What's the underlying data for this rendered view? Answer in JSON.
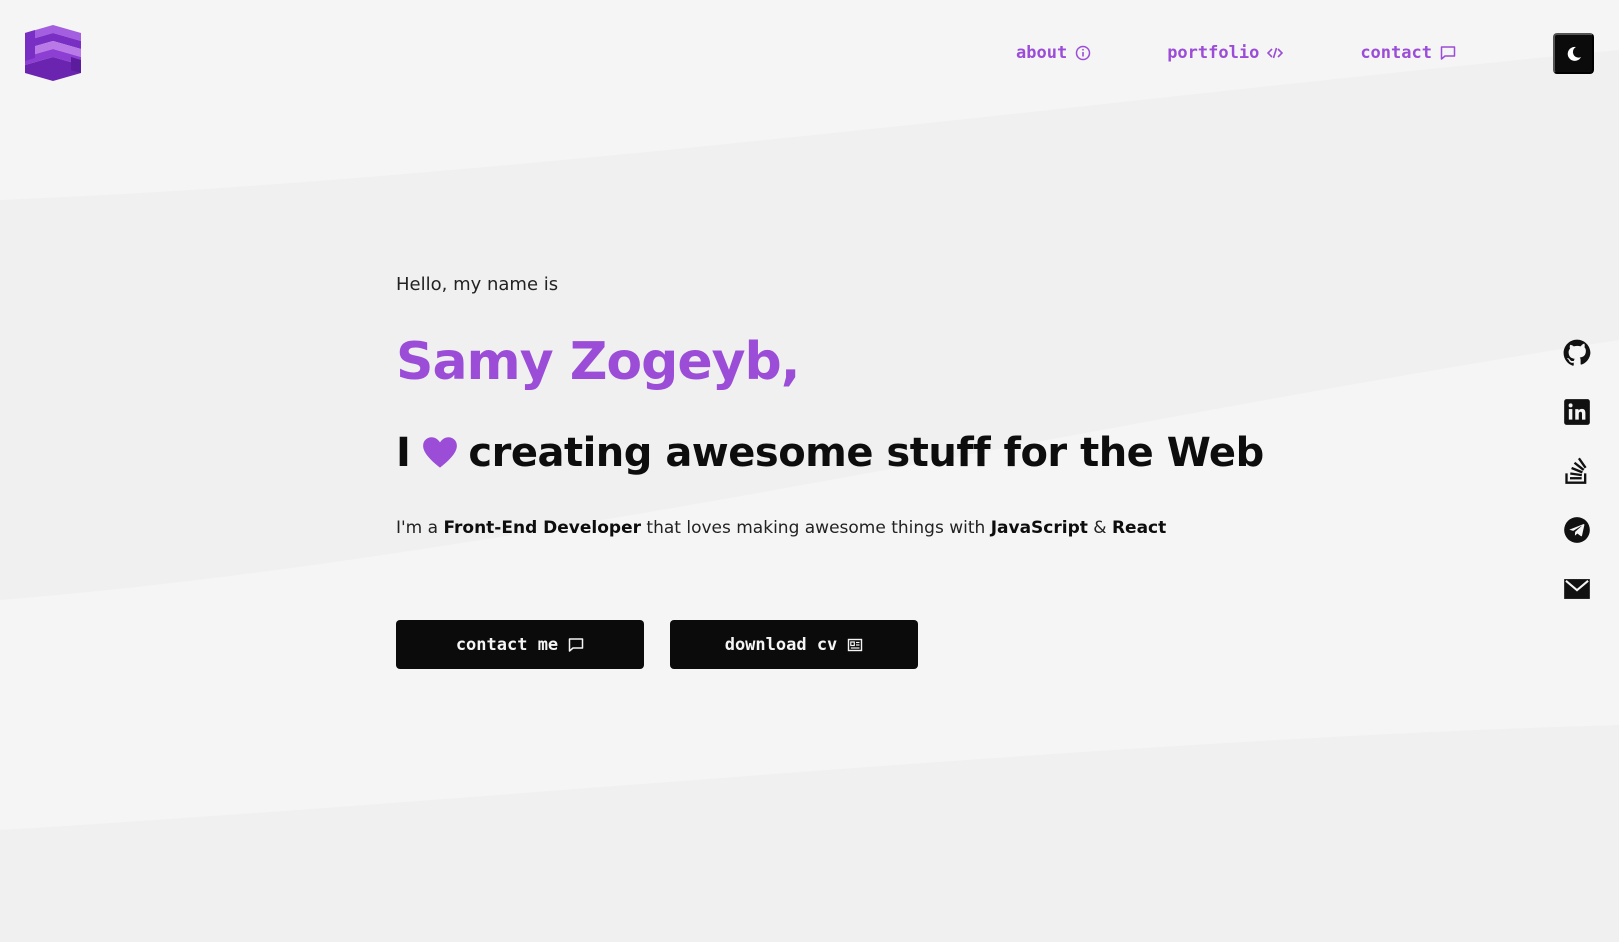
{
  "header": {
    "nav": [
      {
        "label": "about",
        "icon": "info-icon"
      },
      {
        "label": "portfolio",
        "icon": "code-icon"
      },
      {
        "label": "contact",
        "icon": "chat-icon"
      }
    ],
    "theme_toggle_icon": "moon-icon"
  },
  "hero": {
    "greeting": "Hello, my name is",
    "name": "Samy Zogeyb,",
    "tagline_prefix": "I",
    "tagline_suffix": "creating awesome stuff for the Web",
    "intro": {
      "part1": "I'm a ",
      "role": "Front-End Developer",
      "part2": " that loves making awesome things with ",
      "tech1": "JavaScript",
      "part3": " & ",
      "tech2": "React"
    },
    "buttons": {
      "contact": "contact me",
      "cv": "download cv"
    }
  },
  "social": [
    {
      "name": "github-icon"
    },
    {
      "name": "linkedin-icon"
    },
    {
      "name": "stackoverflow-icon"
    },
    {
      "name": "telegram-icon"
    },
    {
      "name": "email-icon"
    }
  ],
  "colors": {
    "accent": "#9b4dd8",
    "background": "#f5f5f5",
    "dark": "#0b0b0b"
  }
}
